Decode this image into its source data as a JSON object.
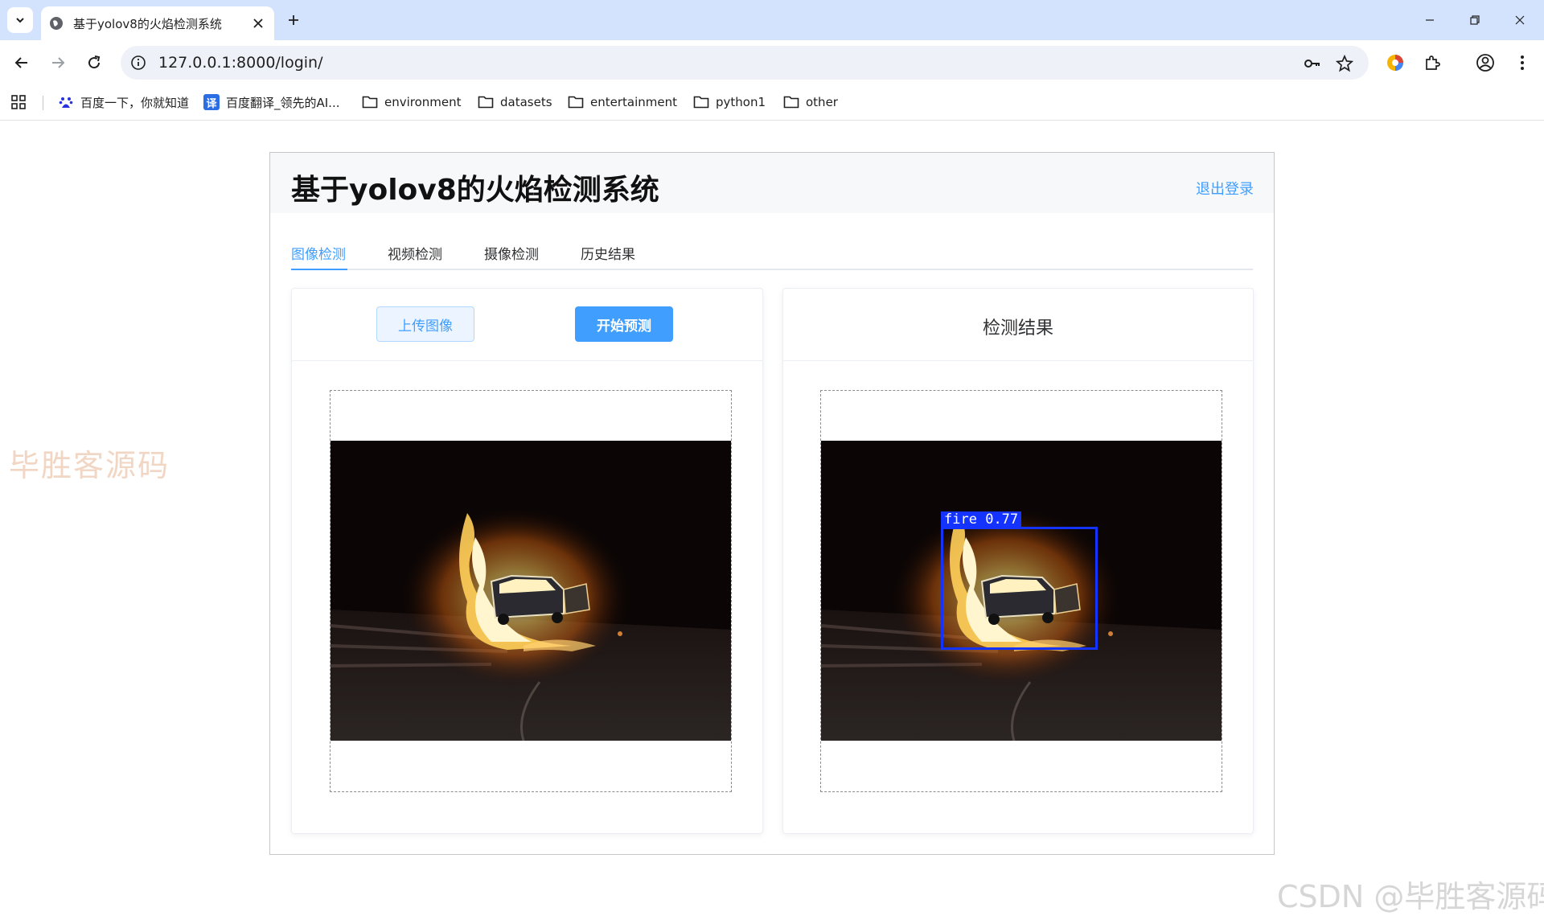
{
  "browser": {
    "tab_title": "基于yolov8的火焰检测系统",
    "url": "127.0.0.1:8000/login/",
    "bookmarks": [
      {
        "label": "百度一下，你就知道",
        "icon": "baidu-icon"
      },
      {
        "label": "百度翻译_领先的AI...",
        "icon": "translate-icon"
      },
      {
        "label": "environment",
        "icon": "folder-icon"
      },
      {
        "label": "datasets",
        "icon": "folder-icon"
      },
      {
        "label": "entertainment",
        "icon": "folder-icon"
      },
      {
        "label": "python1",
        "icon": "folder-icon"
      },
      {
        "label": "other",
        "icon": "folder-icon"
      }
    ],
    "translate_glyph": "译"
  },
  "app": {
    "title": "基于yolov8的火焰检测系统",
    "logout": "退出登录",
    "tabs": [
      "图像检测",
      "视频检测",
      "摄像检测",
      "历史结果"
    ],
    "active_tab": 0,
    "upload_button": "上传图像",
    "predict_button": "开始预测",
    "result_title": "检测结果",
    "detection": {
      "label": "fire",
      "confidence": "0.77"
    }
  },
  "watermarks": {
    "left": "毕胜客源码",
    "right": "CSDN @毕胜客源码"
  },
  "colors": {
    "accent": "#409eff",
    "tabbar": "#d3e3fd",
    "detection_box": "#1433ff"
  }
}
